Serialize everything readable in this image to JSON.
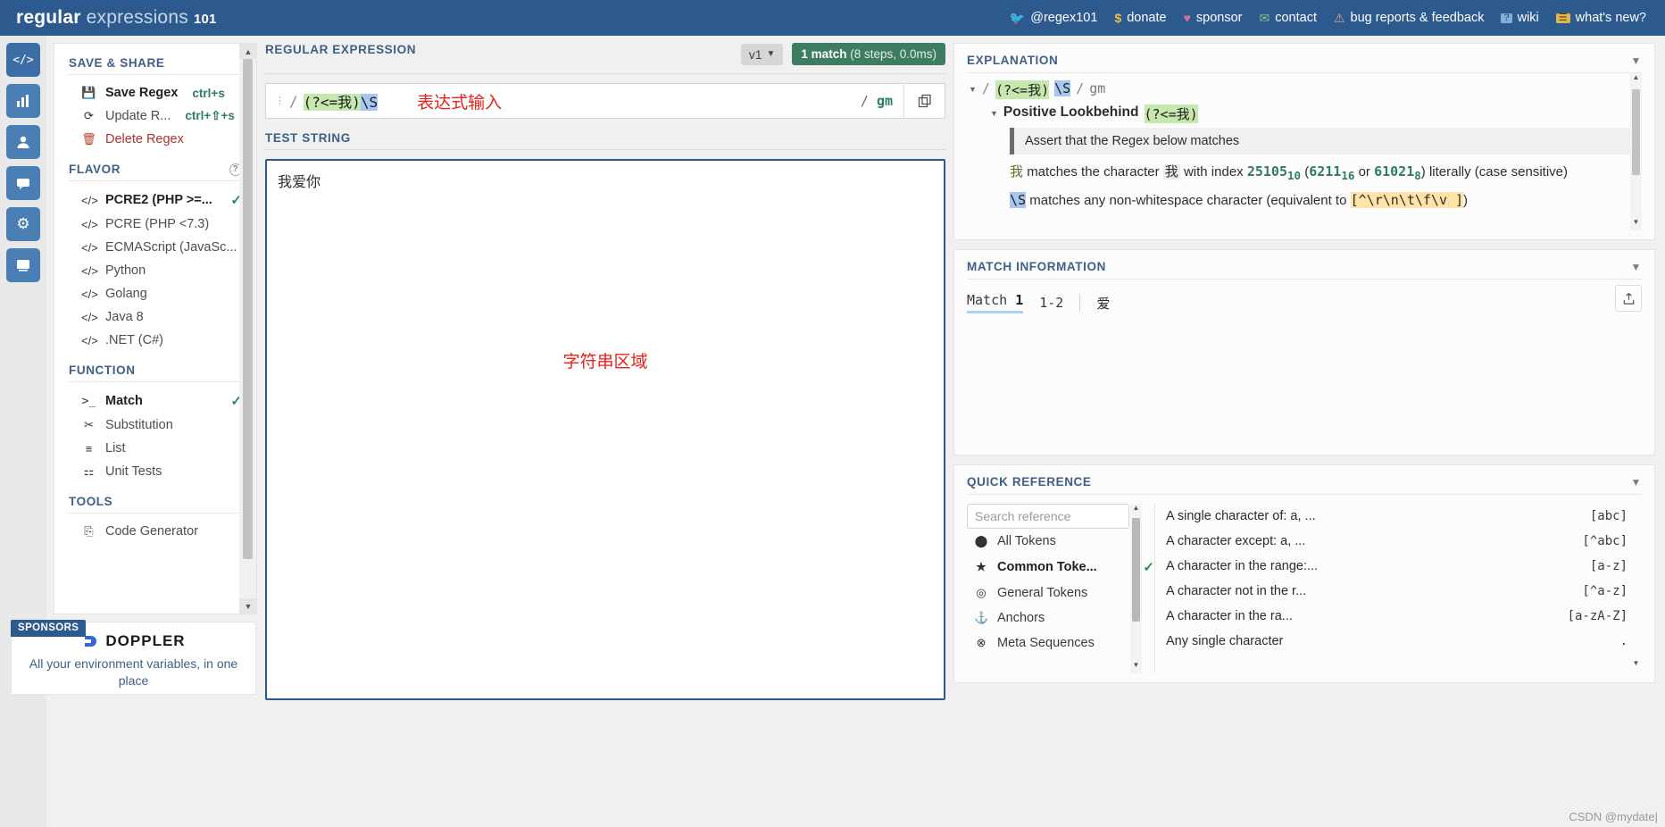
{
  "brand": {
    "word1": "regular",
    "word2": "expressions",
    "num": "101"
  },
  "topnav": [
    {
      "icon": "twitter-icon",
      "glyph": "🐦",
      "label": "@regex101",
      "color": "#6fb7e8"
    },
    {
      "icon": "dollar-icon",
      "glyph": "$",
      "label": "donate",
      "color": "#e8c04a"
    },
    {
      "icon": "heart-icon",
      "glyph": "♥",
      "label": "sponsor",
      "color": "#d4728d"
    },
    {
      "icon": "envelope-icon",
      "glyph": "✉",
      "label": "contact",
      "color": "#8fbf8f"
    },
    {
      "icon": "warning-icon",
      "glyph": "⚠",
      "label": "bug reports & feedback",
      "color": "#e0a878"
    },
    {
      "icon": "wiki-icon",
      "glyph": "?",
      "label": "wiki",
      "color": "#7fb0d8"
    },
    {
      "icon": "news-icon",
      "glyph": "☰",
      "label": "what's new?",
      "color": "#e0b84a"
    }
  ],
  "rail": [
    {
      "name": "code-icon",
      "glyph": "</>"
    },
    {
      "name": "chart-icon",
      "glyph": "▐▐"
    },
    {
      "name": "account-icon",
      "glyph": "●"
    },
    {
      "name": "chat-icon",
      "glyph": "▭"
    },
    {
      "name": "gear-icon",
      "glyph": "⚙"
    },
    {
      "name": "community-icon",
      "glyph": "❐"
    }
  ],
  "sidebar": {
    "save_share": {
      "title": "SAVE & SHARE",
      "items": [
        {
          "icon": "floppy-icon",
          "glyph": "💾",
          "label": "Save Regex",
          "kbd": "ctrl+s",
          "bold": true
        },
        {
          "icon": "refresh-icon",
          "glyph": "⟳",
          "label": "Update R...",
          "kbd": "ctrl+⇧+s",
          "bold": false
        },
        {
          "icon": "trash-icon",
          "glyph": "🗑",
          "label": "Delete Regex",
          "kbd": "",
          "danger": true
        }
      ]
    },
    "flavor": {
      "title": "FLAVOR",
      "help": "?",
      "items": [
        {
          "icon": "code-icon",
          "glyph": "</>",
          "label": "PCRE2 (PHP >=...",
          "selected": true
        },
        {
          "icon": "code-icon",
          "glyph": "</>",
          "label": "PCRE (PHP <7.3)",
          "selected": false
        },
        {
          "icon": "code-icon",
          "glyph": "</>",
          "label": "ECMAScript (JavaSc...",
          "selected": false
        },
        {
          "icon": "code-icon",
          "glyph": "</>",
          "label": "Python",
          "selected": false
        },
        {
          "icon": "code-icon",
          "glyph": "</>",
          "label": "Golang",
          "selected": false
        },
        {
          "icon": "code-icon",
          "glyph": "</>",
          "label": "Java 8",
          "selected": false
        },
        {
          "icon": "code-icon",
          "glyph": "</>",
          "label": ".NET (C#)",
          "selected": false
        }
      ]
    },
    "function": {
      "title": "FUNCTION",
      "items": [
        {
          "icon": "terminal-icon",
          "glyph": ">_",
          "label": "Match",
          "selected": true
        },
        {
          "icon": "scissors-icon",
          "glyph": "✂",
          "label": "Substitution",
          "selected": false
        },
        {
          "icon": "list-icon",
          "glyph": "≡",
          "label": "List",
          "selected": false
        },
        {
          "icon": "test-tube-icon",
          "glyph": "🧪",
          "label": "Unit Tests",
          "selected": false
        }
      ]
    },
    "tools": {
      "title": "TOOLS",
      "items": [
        {
          "icon": "code-file-icon",
          "glyph": "⎘",
          "label": "Code Generator",
          "selected": false
        }
      ]
    }
  },
  "sponsor": {
    "tag": "SPONSORS",
    "name": "DOPPLER",
    "tagline": "All your environment variables, in one place"
  },
  "regex_panel": {
    "title": "REGULAR EXPRESSION",
    "version": "v1",
    "match_badge_main": "1 match",
    "match_badge_detail": "(8 steps, 0.0ms)",
    "pattern_parts": [
      {
        "text": "(?<=我)",
        "hl": "green"
      },
      {
        "text": "\\S",
        "hl": "blue"
      }
    ],
    "pattern_plain": "(?<=我)\\S",
    "annotation": "表达式输入",
    "flags": "gm",
    "copy_icon": "copy-icon"
  },
  "test_string": {
    "title": "TEST STRING",
    "value": "我爱你",
    "annotation": "字符串区域"
  },
  "explanation": {
    "title": "EXPLANATION",
    "header_slash": "/",
    "header_flags": "gm",
    "lookbehind_label": "Positive Lookbehind",
    "lookbehind_token": "(?<=我)",
    "assert_text": "Assert that the Regex below matches",
    "char_line_a": "我",
    "char_line_b": "matches the character",
    "char_line_c": "我",
    "char_line_d": "with index",
    "char_dec": "25105",
    "char_dec_sub": "10",
    "char_hex": "6211",
    "char_hex_sub": "16",
    "char_or": "or",
    "char_oct": "61021",
    "char_oct_sub": "8",
    "char_tail": ") literally (case sensitive)",
    "ns_token": "\\S",
    "ns_text": "matches any non-whitespace character (equivalent to",
    "ns_class": "[^\\r\\n\\t\\f\\v ]",
    "ns_tail": ")"
  },
  "match_information": {
    "title": "MATCH INFORMATION",
    "match_label": "Match",
    "match_number": "1",
    "range": "1-2",
    "value": "爱",
    "export_icon": "export-icon"
  },
  "quick_reference": {
    "title": "QUICK REFERENCE",
    "search_placeholder": "Search reference",
    "categories": [
      {
        "icon": "ink-icon",
        "glyph": "⬤",
        "label": "All Tokens",
        "selected": false
      },
      {
        "icon": "star-icon",
        "glyph": "★",
        "label": "Common Toke...",
        "selected": true
      },
      {
        "icon": "target-icon",
        "glyph": "◎",
        "label": "General Tokens",
        "selected": false
      },
      {
        "icon": "anchor-icon",
        "glyph": "⚓",
        "label": "Anchors",
        "selected": false
      },
      {
        "icon": "meta-icon",
        "glyph": "⊗",
        "label": "Meta Sequences",
        "selected": false
      }
    ],
    "entries": [
      {
        "desc": "A single character of: a, ...",
        "token": "[abc]"
      },
      {
        "desc": "A character except: a, ...",
        "token": "[^abc]"
      },
      {
        "desc": "A character in the range:...",
        "token": "[a-z]"
      },
      {
        "desc": "A character not in the r...",
        "token": "[^a-z]"
      },
      {
        "desc": "A character in the ra...",
        "token": "[a-zA-Z]"
      },
      {
        "desc": "Any single character",
        "token": "."
      }
    ]
  },
  "watermark": "CSDN @mydate|"
}
